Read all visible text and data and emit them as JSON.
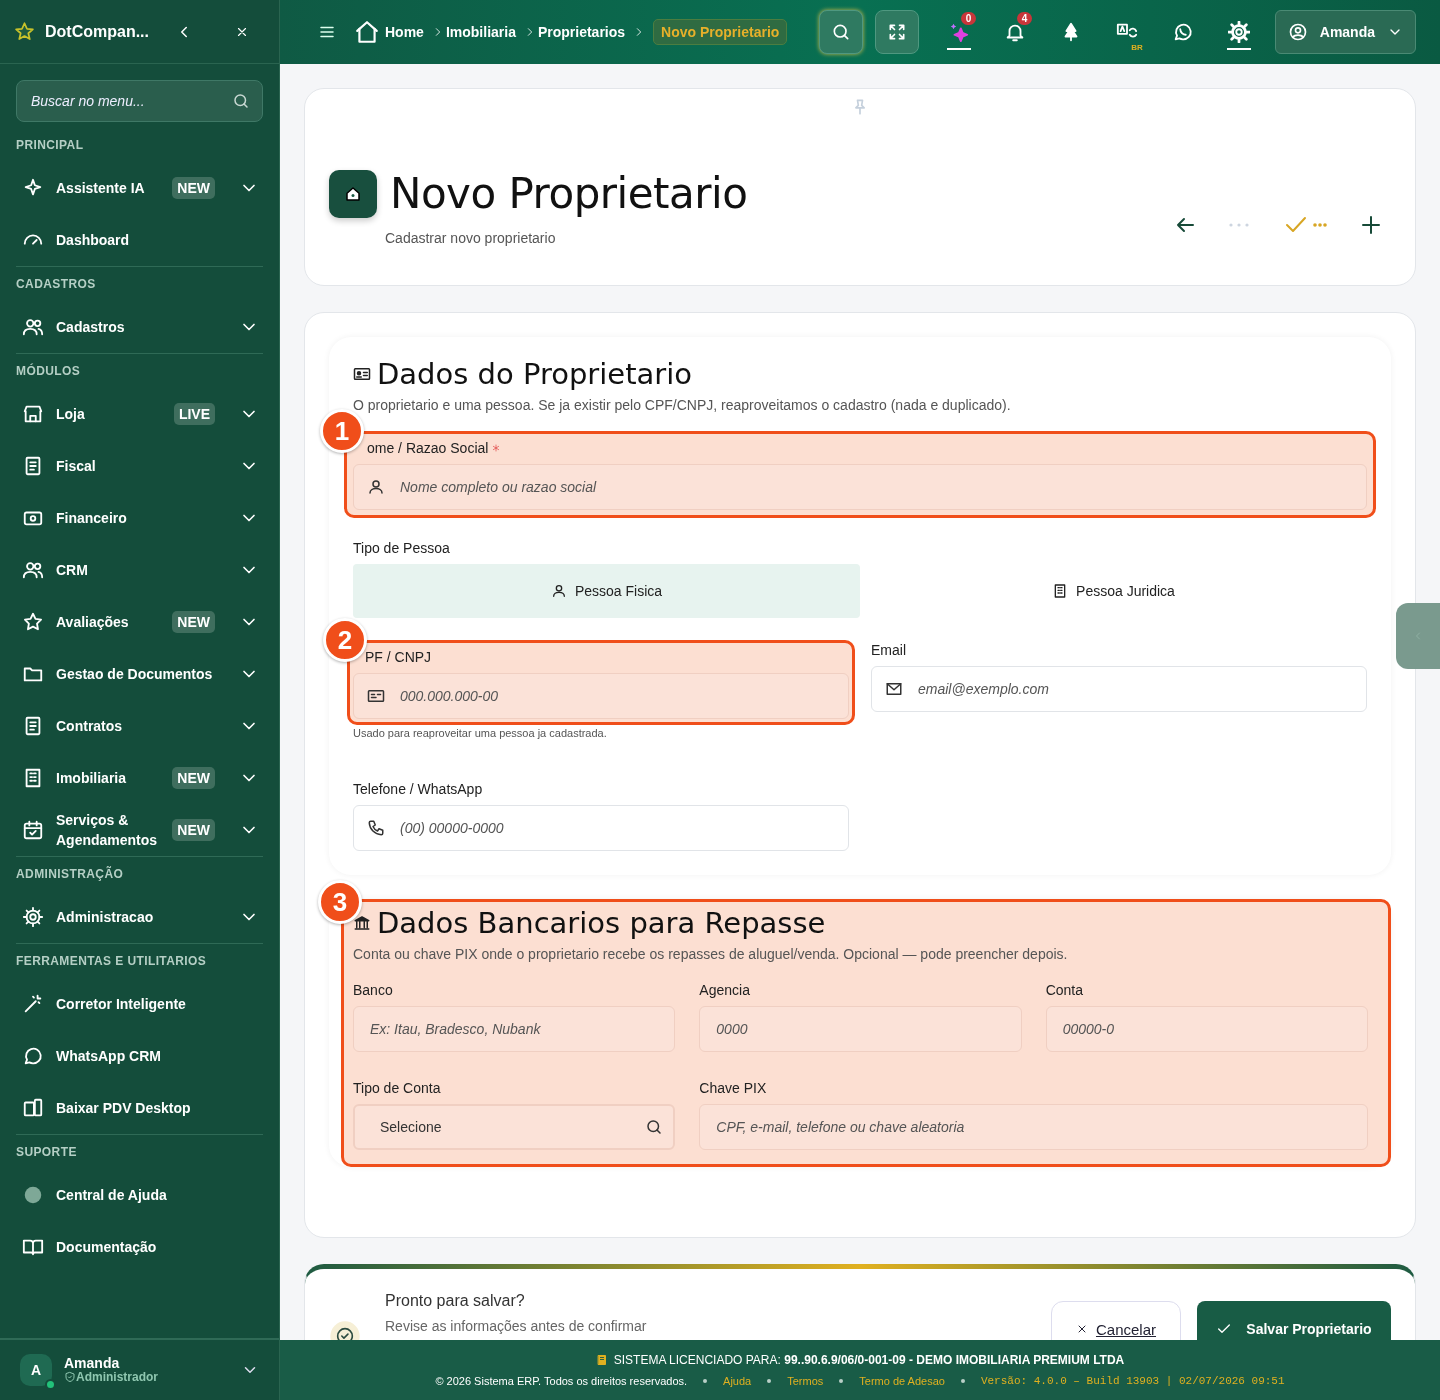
{
  "sidebar": {
    "brand": "DotCompan...",
    "search": {
      "placeholder": "Buscar no menu..."
    },
    "sections": [
      {
        "title": "PRINCIPAL",
        "items": [
          {
            "label": "Assistente IA",
            "badge": "NEW",
            "has_submenu": true
          },
          {
            "label": "Dashboard",
            "has_submenu": false
          }
        ]
      },
      {
        "title": "CADASTROS",
        "items": [
          {
            "label": "Cadastros",
            "has_submenu": true
          }
        ]
      },
      {
        "title": "MÓDULOS",
        "items": [
          {
            "label": "Loja",
            "badge": "LIVE",
            "has_submenu": true
          },
          {
            "label": "Fiscal",
            "has_submenu": true
          },
          {
            "label": "Financeiro",
            "has_submenu": true
          },
          {
            "label": "CRM",
            "has_submenu": true
          },
          {
            "label": "Avaliações",
            "badge": "NEW",
            "has_submenu": true
          },
          {
            "label": "Gestao de Documentos",
            "has_submenu": true
          },
          {
            "label": "Contratos",
            "has_submenu": true
          },
          {
            "label": "Imobiliaria",
            "badge": "NEW",
            "has_submenu": true
          },
          {
            "label": "Serviços & Agendamentos",
            "badge": "NEW",
            "has_submenu": true
          }
        ]
      },
      {
        "title": "ADMINISTRAÇÃO",
        "items": [
          {
            "label": "Administracao",
            "has_submenu": true
          }
        ]
      },
      {
        "title": "FERRAMENTAS E UTILITARIOS",
        "items": [
          {
            "label": "Corretor Inteligente",
            "has_submenu": false
          },
          {
            "label": "WhatsApp CRM",
            "has_submenu": false
          },
          {
            "label": "Baixar PDV Desktop",
            "has_submenu": false
          }
        ]
      },
      {
        "title": "SUPORTE",
        "items": [
          {
            "label": "Central de Ajuda",
            "has_submenu": false
          },
          {
            "label": "Documentação",
            "has_submenu": false
          }
        ]
      }
    ],
    "user": {
      "initial": "A",
      "name": "Amanda",
      "role": "Administrador",
      "online": true
    }
  },
  "topbar": {
    "breadcrumb": [
      "Home",
      "Imobiliaria",
      "Proprietarios"
    ],
    "current": "Novo Proprietario",
    "ai_count": "0",
    "notification_count": "4",
    "language": "BR",
    "user": "Amanda"
  },
  "header": {
    "title": "Novo Proprietario",
    "subtitle": "Cadastrar novo proprietario"
  },
  "owner_section": {
    "title": "Dados do Proprietario",
    "description": "O proprietario e uma pessoa. Se ja existir pelo CPF/CNPJ, reaproveitamos o cadastro (nada e duplicado).",
    "name_field": {
      "label": "ome / Razao Social",
      "required": true,
      "placeholder": "Nome completo ou razao social",
      "callout": "1"
    },
    "person_type": {
      "label": "Tipo de Pessoa",
      "options": [
        {
          "label": "Pessoa Fisica",
          "selected": true
        },
        {
          "label": "Pessoa Juridica",
          "selected": false
        }
      ]
    },
    "document_field": {
      "label": "PF / CNPJ",
      "placeholder": "000.000.000-00",
      "hint": "Usado para reaproveitar uma pessoa ja cadastrada.",
      "callout": "2"
    },
    "email_field": {
      "label": "Email",
      "placeholder": "email@exemplo.com"
    },
    "phone_field": {
      "label": "Telefone / WhatsApp",
      "placeholder": "(00) 00000-0000"
    }
  },
  "bank_section": {
    "title": "Dados Bancarios para Repasse",
    "description": "Conta ou chave PIX onde o proprietario recebe os repasses de aluguel/venda. Opcional — pode preencher depois.",
    "callout": "3",
    "fields": [
      {
        "kind": "text",
        "label": "Banco",
        "placeholder": "Ex: Itau, Bradesco, Nubank"
      },
      {
        "kind": "text",
        "label": "Agencia",
        "placeholder": "0000"
      },
      {
        "kind": "text",
        "label": "Conta",
        "placeholder": "00000-0"
      },
      {
        "kind": "select",
        "label": "Tipo de Conta",
        "value": "Selecione"
      },
      {
        "kind": "text",
        "label": "Chave PIX",
        "placeholder": "CPF, e-mail, telefone ou chave aleatoria",
        "wide": true
      }
    ]
  },
  "save_bar": {
    "title": "Pronto para salvar?",
    "subtitle": "Revise as informações antes de confirmar",
    "cancel": "Cancelar",
    "save": "Salvar Proprietario"
  },
  "status_bar": {
    "license": "SISTEMA LICENCIADO PARA: **99..90.6.9/06/0-001-09 - DEMO IMOBILIARIA PREMIUM LTDA**",
    "copyright": "© 2026 Sistema ERP. Todos os direitos reservados.",
    "links": [
      "Ajuda",
      "Termos",
      "Termo de Adesao"
    ],
    "version": "Versão: 4.0.0 – Build 13903 | 02/07/2026 09:51"
  }
}
